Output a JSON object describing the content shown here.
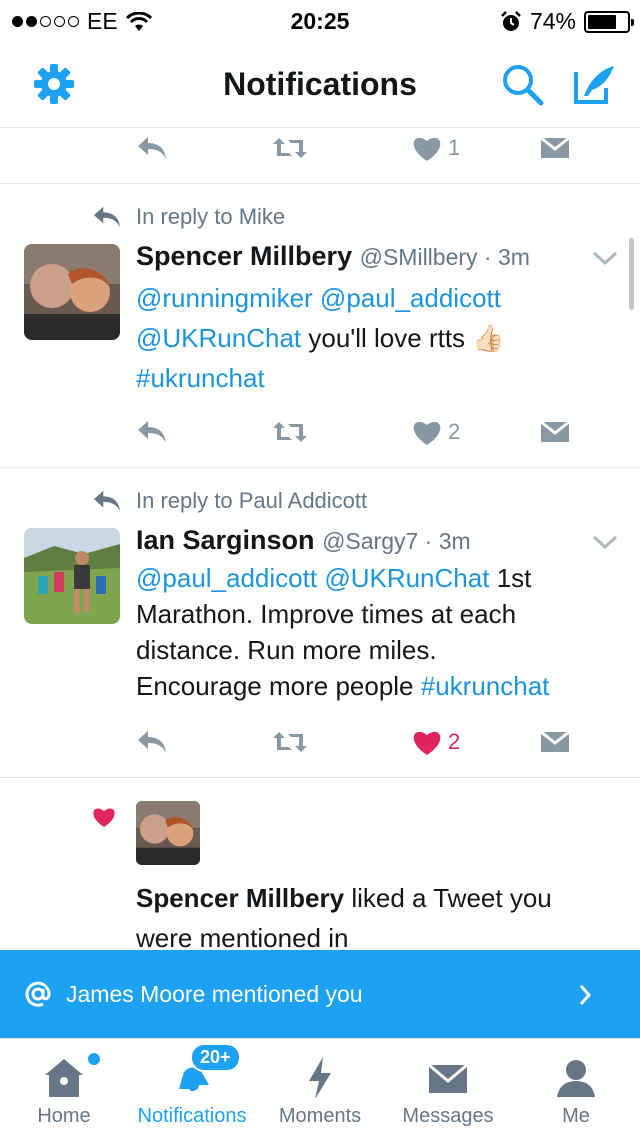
{
  "status_bar": {
    "carrier": "EE",
    "time": "20:25",
    "battery": "74%",
    "battery_level": 0.74
  },
  "header": {
    "title": "Notifications",
    "left_icon": "gear-icon",
    "right_icons": [
      "search-icon",
      "compose-icon"
    ]
  },
  "colors": {
    "accent": "#1da1f2",
    "like": "#e0245e",
    "muted": "#8899a6"
  },
  "top_actions": {
    "like_count": "1"
  },
  "tweets": [
    {
      "reply_to": "In reply to Mike",
      "name": "Spencer Millbery",
      "handle_time": "@SMillbery · 3m",
      "mention1": "@runningmiker",
      "mention2": "@paul_addicott",
      "mention3": "@UKRunChat",
      "text": "you'll love rtts",
      "emoji": "👍🏻",
      "hashtag": "#ukrunchat",
      "like_count": "2",
      "liked": false
    },
    {
      "reply_to": "In reply to Paul Addicott",
      "name": "Ian Sarginson",
      "handle_time": "@Sargy7 · 3m",
      "mention1": "@paul_addicott",
      "mention2": "@UKRunChat",
      "text_a": "1st",
      "text_b": "Marathon. Improve times at each",
      "text_c": "distance. Run more miles.",
      "text_d": "Encourage more people",
      "hashtag": "#ukrunchat",
      "like_count": "2",
      "liked": true
    }
  ],
  "like_notification": {
    "name": "Spencer Millbery",
    "text_line1": "liked a Tweet you",
    "text_line2": "were mentioned in"
  },
  "banner": {
    "text": "James Moore mentioned you"
  },
  "tabs": [
    {
      "label": "Home",
      "icon": "home-icon"
    },
    {
      "label": "Notifications",
      "icon": "bell-icon",
      "badge": "20+"
    },
    {
      "label": "Moments",
      "icon": "lightning-icon"
    },
    {
      "label": "Messages",
      "icon": "envelope-icon"
    },
    {
      "label": "Me",
      "icon": "person-icon"
    }
  ]
}
